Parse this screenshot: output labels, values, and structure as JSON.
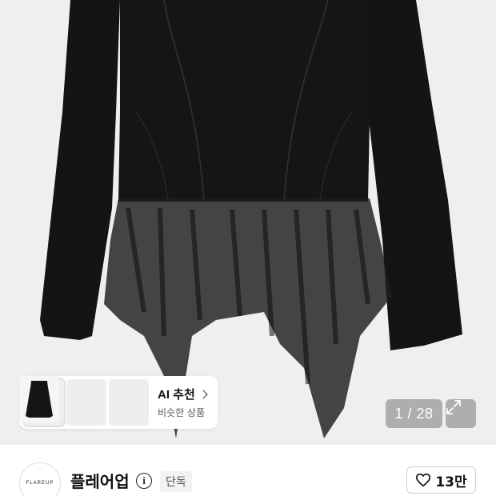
{
  "gallery": {
    "counter": "1 / 28",
    "expand_icon": "expand-icon"
  },
  "ai_recommend": {
    "title": "AI 추천",
    "subtitle": "비슷한 상품",
    "chevron_icon": "chevron-right-icon"
  },
  "brand": {
    "logo_text": "FLAREUP",
    "name": "플레어업",
    "info_icon": "info-icon",
    "tag": "단독"
  },
  "like": {
    "icon": "heart-icon",
    "count": "13만"
  },
  "colors": {
    "background": "#efefef",
    "garment": "#111111",
    "overlay": "#8a8a8a"
  }
}
